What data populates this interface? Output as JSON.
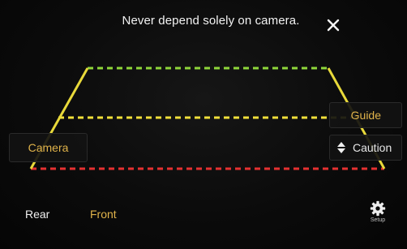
{
  "warning_text": "Never depend solely on camera.",
  "close": {
    "icon": "close-icon"
  },
  "buttons": {
    "camera_label": "Camera",
    "guide_label": "Guide",
    "caution_label": "Caution"
  },
  "tabs": {
    "rear_label": "Rear",
    "front_label": "Front",
    "active": "Front"
  },
  "setup": {
    "label": "Setup",
    "icon": "gear-icon"
  },
  "guide_lines": {
    "colors": {
      "far": "#8fd63a",
      "mid": "#f2e03a",
      "near": "#e53131",
      "sides": "#e8d93a"
    }
  },
  "colors": {
    "accent": "#e0b34a",
    "text": "#f0f0f0"
  }
}
